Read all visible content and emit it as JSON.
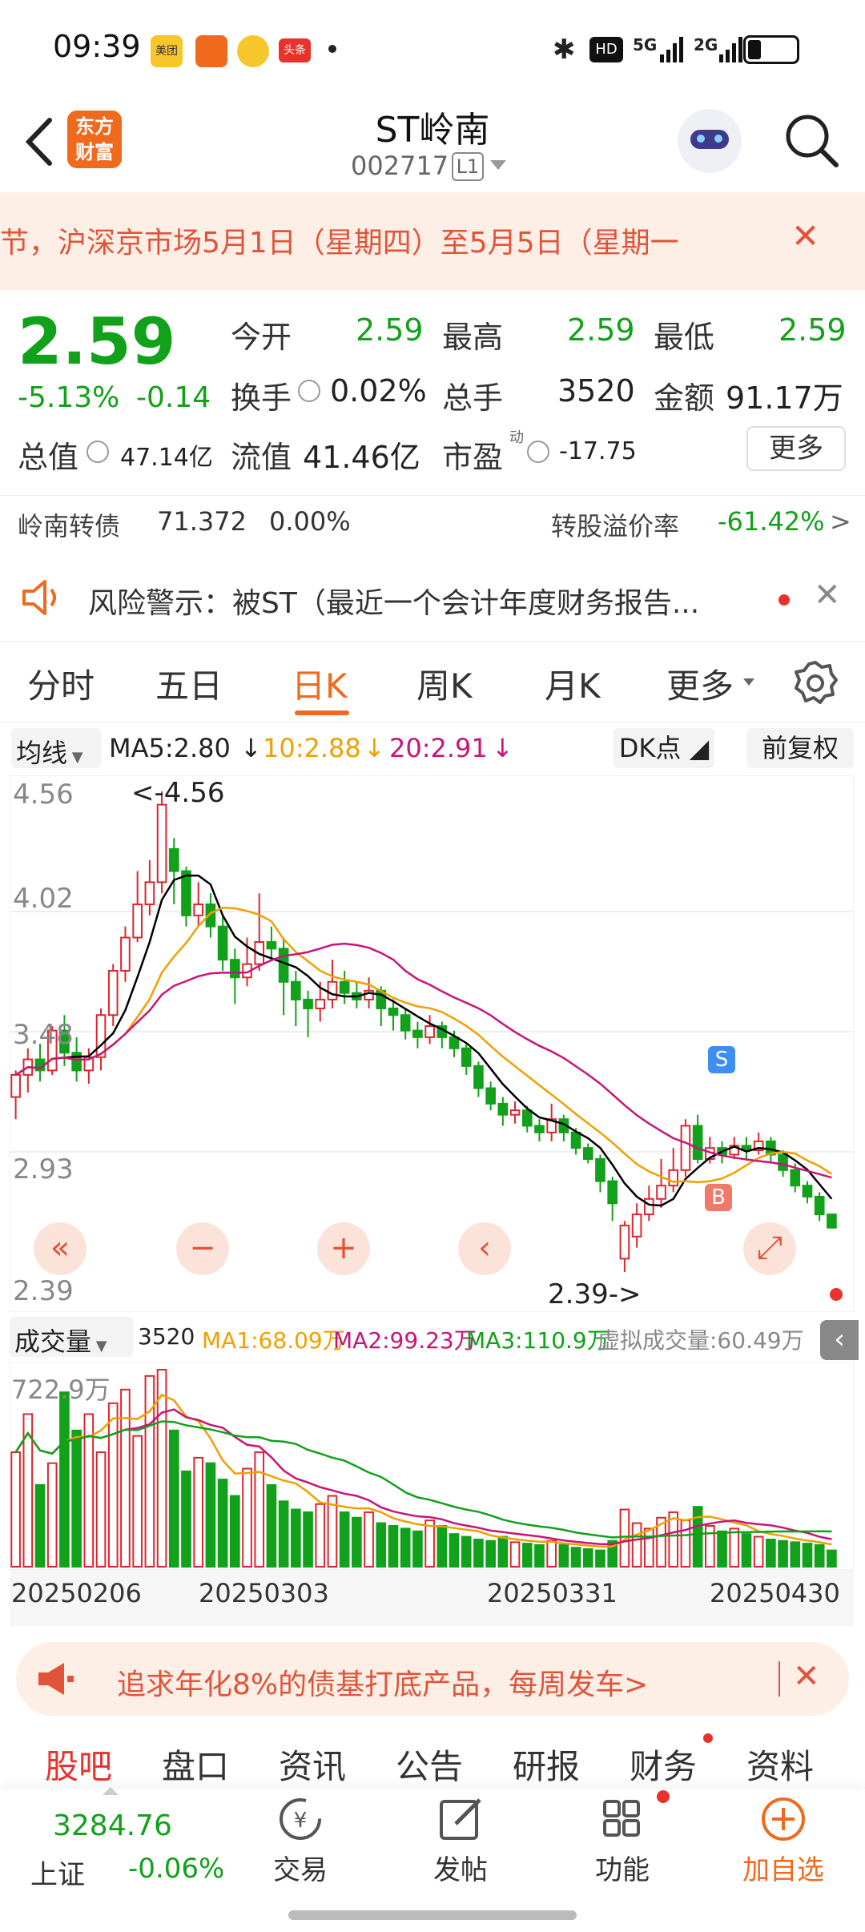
{
  "status": {
    "time": "09:39",
    "apps": [
      "美团",
      "头条"
    ],
    "net": [
      "HD",
      "5G",
      "2G"
    ]
  },
  "header": {
    "title": "ST岭南",
    "code": "002717",
    "level": "L1",
    "logo_line1": "东方",
    "logo_line2": "财富"
  },
  "notice": {
    "text": "节，沪深京市场5月1日（星期四）至5月5日（星期一",
    "close": "✕"
  },
  "quote": {
    "price": "2.59",
    "change_pct": "-5.13%",
    "change": "-0.14",
    "open_label": "今开",
    "open": "2.59",
    "high_label": "最高",
    "high": "2.59",
    "low_label": "最低",
    "low": "2.59",
    "turnover_label": "换手",
    "turnover": "0.02%",
    "volume_label": "总手",
    "volume": "3520",
    "amount_label": "金额",
    "amount": "91.17万",
    "mcap_label": "总值",
    "mcap": "47.14亿",
    "float_label": "流值",
    "float": "41.46亿",
    "pe_label": "市盈",
    "pe_sup": "动",
    "pe": "-17.75",
    "more": "更多"
  },
  "bond": {
    "name": "岭南转债",
    "price": "71.372",
    "pct": "0.00%",
    "premium_label": "转股溢价率",
    "premium": "-61.42%",
    "arrow": ">"
  },
  "risk": {
    "text": "风险警示：被ST（最近一个会计年度财务报告...",
    "close": "✕"
  },
  "tabs": [
    "分时",
    "五日",
    "日K",
    "周K",
    "月K",
    "更多"
  ],
  "active_tab": "日K",
  "ma": {
    "type": "均线",
    "ma5": "MA5:2.80",
    "ma10": "10:2.88",
    "ma20": "20:2.91",
    "dk": "DK点",
    "fq": "前复权"
  },
  "chart_labels": {
    "y1": "4.56",
    "y2": "4.02",
    "y3": "3.48",
    "y4": "2.93",
    "y5": "2.39",
    "high_mark": "<-4.56",
    "low_mark": "2.39->",
    "sell": "S",
    "buy": "B"
  },
  "vol": {
    "type": "成交量",
    "v": "3520",
    "ma1": "MA1:68.09万",
    "ma2": "MA2:99.23万",
    "ma3": "MA3:110.9万",
    "virtual": "虚拟成交量:60.49万",
    "max": "722.9万"
  },
  "x_dates": [
    "20250206",
    "20250303",
    "20250331",
    "20250430"
  ],
  "promo": {
    "text": "追求年化8%的债基打底产品，每周发车>",
    "close": "✕"
  },
  "bottom_tabs": [
    "股吧",
    "盘口",
    "资讯",
    "公告",
    "研报",
    "财务",
    "资料"
  ],
  "index": {
    "value": "3284.76",
    "name": "上证",
    "pct": "-0.06%"
  },
  "nav": [
    "交易",
    "发帖",
    "功能",
    "加自选"
  ],
  "colors": {
    "up": "#d9272e",
    "down": "#11a11a",
    "accent": "#f06a1d",
    "ma5": "#000000",
    "ma10": "#f0a000",
    "ma20": "#c8147a"
  },
  "chart_data": {
    "type": "candlestick",
    "ylim": [
      2.39,
      4.56
    ],
    "x_ticks": [
      "20250206",
      "20250303",
      "20250331",
      "20250430"
    ],
    "candles": [
      [
        3.18,
        3.28,
        3.3,
        3.08
      ],
      [
        3.28,
        3.35,
        3.4,
        3.2
      ],
      [
        3.35,
        3.3,
        3.42,
        3.25
      ],
      [
        3.3,
        3.48,
        3.5,
        3.28
      ],
      [
        3.48,
        3.38,
        3.55,
        3.32
      ],
      [
        3.38,
        3.3,
        3.45,
        3.25
      ],
      [
        3.3,
        3.36,
        3.4,
        3.24
      ],
      [
        3.36,
        3.55,
        3.58,
        3.3
      ],
      [
        3.55,
        3.75,
        3.78,
        3.5
      ],
      [
        3.75,
        3.9,
        3.95,
        3.7
      ],
      [
        3.9,
        4.05,
        4.2,
        3.88
      ],
      [
        4.05,
        4.15,
        4.25,
        4.0
      ],
      [
        4.15,
        4.5,
        4.56,
        4.1
      ],
      [
        4.3,
        4.2,
        4.35,
        4.05
      ],
      [
        4.2,
        4.0,
        4.22,
        3.95
      ],
      [
        4.0,
        4.05,
        4.15,
        3.95
      ],
      [
        4.05,
        3.95,
        4.1,
        3.9
      ],
      [
        3.95,
        3.8,
        4.0,
        3.75
      ],
      [
        3.8,
        3.72,
        3.85,
        3.6
      ],
      [
        3.72,
        3.78,
        3.9,
        3.68
      ],
      [
        3.78,
        3.88,
        4.1,
        3.75
      ],
      [
        3.88,
        3.85,
        3.95,
        3.8
      ],
      [
        3.85,
        3.7,
        3.9,
        3.55
      ],
      [
        3.7,
        3.62,
        3.75,
        3.5
      ],
      [
        3.62,
        3.58,
        3.66,
        3.45
      ],
      [
        3.58,
        3.62,
        3.7,
        3.52
      ],
      [
        3.62,
        3.7,
        3.8,
        3.58
      ],
      [
        3.7,
        3.65,
        3.75,
        3.6
      ],
      [
        3.65,
        3.62,
        3.7,
        3.58
      ],
      [
        3.62,
        3.66,
        3.72,
        3.58
      ],
      [
        3.66,
        3.58,
        3.68,
        3.5
      ],
      [
        3.58,
        3.55,
        3.62,
        3.48
      ],
      [
        3.55,
        3.48,
        3.58,
        3.44
      ],
      [
        3.48,
        3.45,
        3.52,
        3.4
      ],
      [
        3.45,
        3.5,
        3.55,
        3.42
      ],
      [
        3.5,
        3.45,
        3.52,
        3.4
      ],
      [
        3.45,
        3.4,
        3.48,
        3.36
      ],
      [
        3.4,
        3.32,
        3.42,
        3.28
      ],
      [
        3.32,
        3.22,
        3.34,
        3.18
      ],
      [
        3.22,
        3.15,
        3.25,
        3.12
      ],
      [
        3.15,
        3.1,
        3.18,
        3.05
      ],
      [
        3.1,
        3.12,
        3.16,
        3.06
      ],
      [
        3.12,
        3.05,
        3.14,
        3.02
      ],
      [
        3.05,
        3.02,
        3.08,
        2.98
      ],
      [
        3.02,
        3.08,
        3.15,
        2.98
      ],
      [
        3.08,
        3.02,
        3.1,
        2.98
      ],
      [
        3.02,
        2.95,
        3.04,
        2.92
      ],
      [
        2.95,
        2.9,
        2.97,
        2.88
      ],
      [
        2.9,
        2.8,
        2.92,
        2.75
      ],
      [
        2.8,
        2.7,
        2.82,
        2.62
      ],
      [
        2.45,
        2.6,
        2.62,
        2.39
      ],
      [
        2.55,
        2.65,
        2.7,
        2.5
      ],
      [
        2.65,
        2.72,
        2.78,
        2.62
      ],
      [
        2.72,
        2.78,
        2.9,
        2.68
      ],
      [
        2.78,
        2.85,
        2.95,
        2.75
      ],
      [
        2.85,
        3.05,
        3.08,
        2.82
      ],
      [
        3.05,
        2.9,
        3.1,
        2.88
      ],
      [
        2.9,
        2.95,
        3.0,
        2.88
      ],
      [
        2.95,
        2.92,
        2.98,
        2.88
      ],
      [
        2.92,
        2.96,
        3.0,
        2.9
      ],
      [
        2.96,
        2.94,
        3.0,
        2.9
      ],
      [
        2.94,
        2.98,
        3.02,
        2.92
      ],
      [
        2.98,
        2.92,
        3.0,
        2.88
      ],
      [
        2.92,
        2.85,
        2.94,
        2.82
      ],
      [
        2.85,
        2.78,
        2.88,
        2.75
      ],
      [
        2.78,
        2.73,
        2.8,
        2.7
      ],
      [
        2.73,
        2.65,
        2.75,
        2.62
      ],
      [
        2.65,
        2.59,
        2.65,
        2.59
      ]
    ],
    "volumes": [
      420,
      560,
      300,
      380,
      640,
      500,
      560,
      420,
      600,
      650,
      480,
      700,
      722.9,
      500,
      350,
      400,
      380,
      320,
      260,
      360,
      420,
      300,
      240,
      210,
      200,
      230,
      260,
      200,
      180,
      200,
      160,
      150,
      140,
      130,
      170,
      150,
      120,
      110,
      100,
      95,
      110,
      90,
      85,
      80,
      95,
      80,
      70,
      65,
      60,
      95,
      210,
      160,
      140,
      180,
      200,
      170,
      220,
      150,
      130,
      140,
      120,
      110,
      100,
      95,
      90,
      85,
      80,
      60
    ]
  }
}
